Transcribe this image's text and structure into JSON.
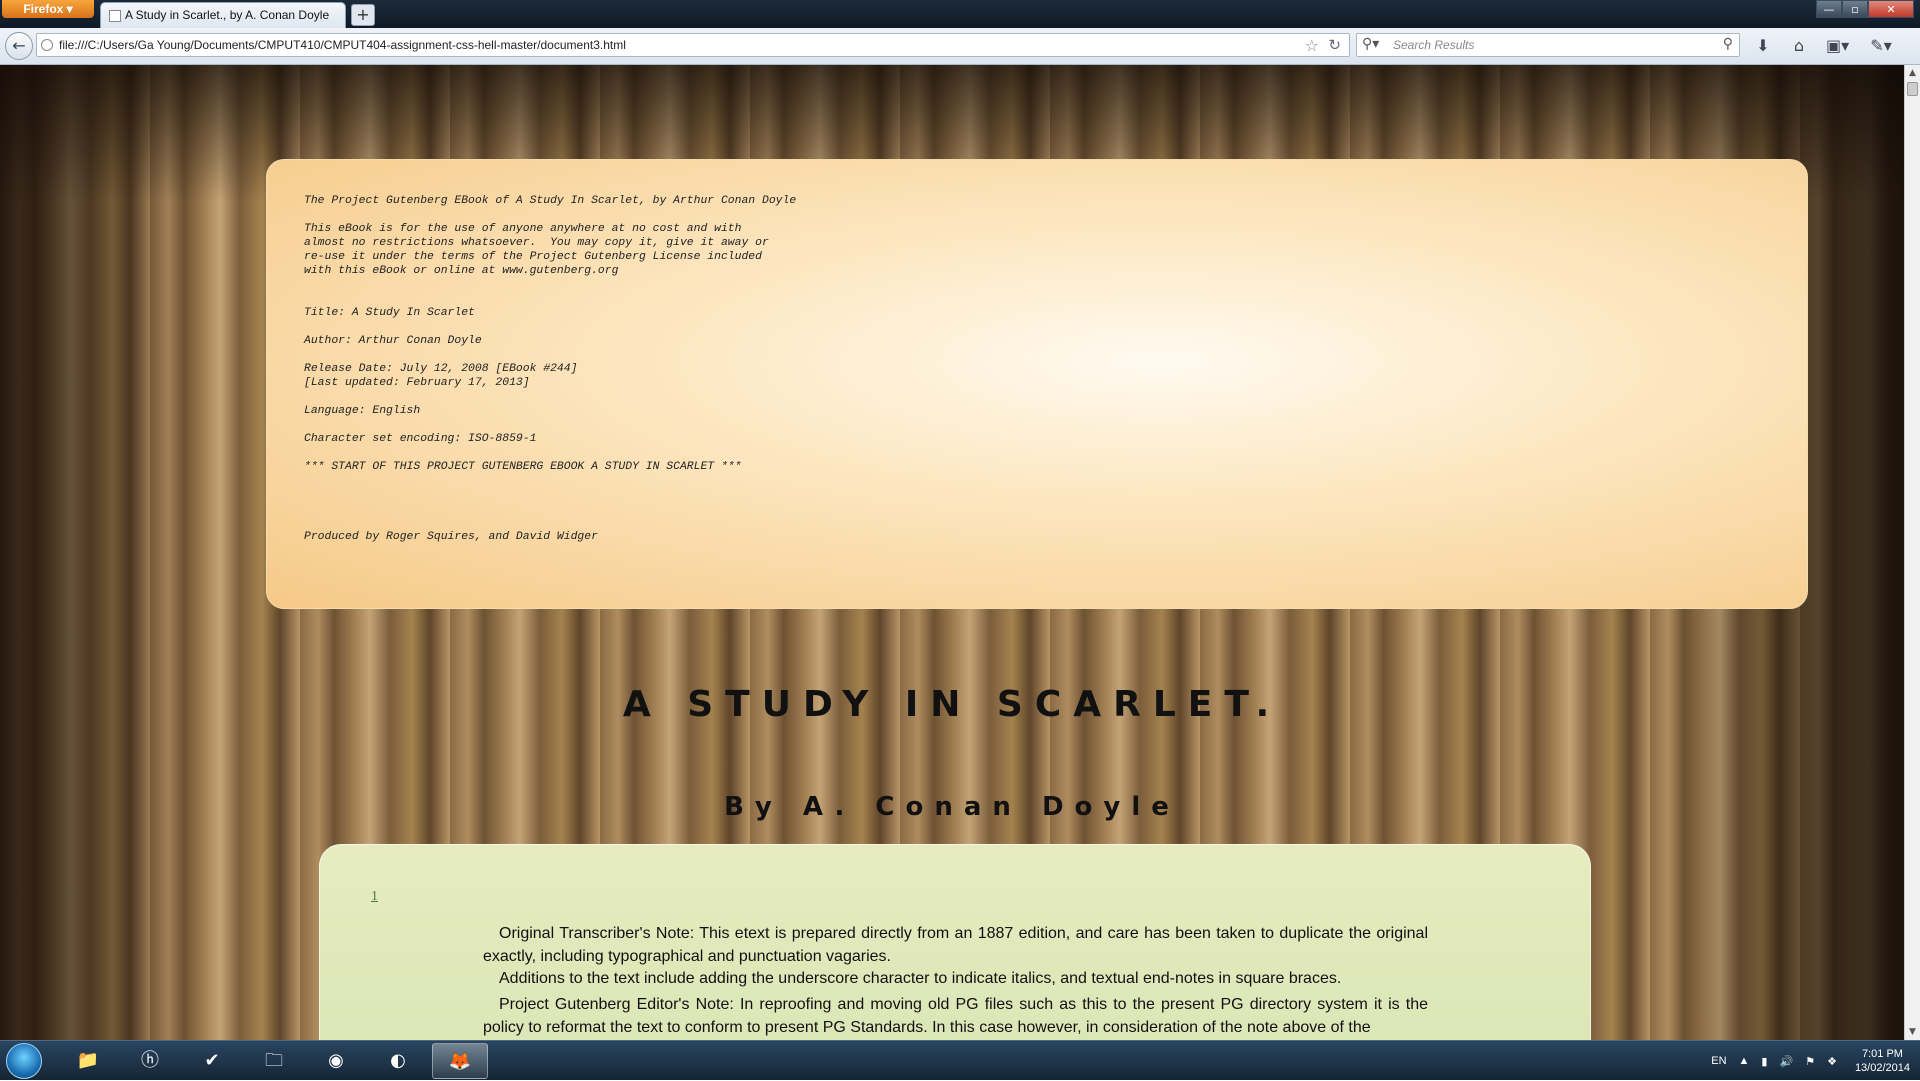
{
  "browser": {
    "menu_button": "Firefox ▾",
    "tab_title": "A Study in Scarlet., by A. Conan Doyle",
    "new_tab": "+",
    "url": "file:///C:/Users/Ga Young/Documents/CMPUT410/CMPUT404-assignment-css-hell-master/document3.html",
    "search_placeholder": "Search Results",
    "window_controls": {
      "minimize": "—",
      "maximize": "▫",
      "close": "✕"
    }
  },
  "page": {
    "license_text": "The Project Gutenberg EBook of A Study In Scarlet, by Arthur Conan Doyle\n\nThis eBook is for the use of anyone anywhere at no cost and with\nalmost no restrictions whatsoever.  You may copy it, give it away or\nre-use it under the terms of the Project Gutenberg License included\nwith this eBook or online at www.gutenberg.org\n\n\nTitle: A Study In Scarlet\n\nAuthor: Arthur Conan Doyle\n\nRelease Date: July 12, 2008 [EBook #244]\n[Last updated: February 17, 2013]\n\nLanguage: English\n\nCharacter set encoding: ISO-8859-1\n\n*** START OF THIS PROJECT GUTENBERG EBOOK A STUDY IN SCARLET ***\n\n\n\n\nProduced by Roger Squires, and David Widger",
    "title": "A STUDY IN SCARLET.",
    "author": "By A. Conan Doyle",
    "page_number": "1",
    "paragraphs": [
      "Original Transcriber's Note: This etext is prepared directly from an 1887 edition, and care has been taken to duplicate the original exactly, including typographical and punctuation vagaries.",
      "Additions to the text include adding the underscore character to indicate italics, and textual end-notes in square braces.",
      "Project Gutenberg Editor's Note: In reproofing and moving old PG files such as this to the present PG directory system it is the policy to reformat the text to conform to present PG Standards. In this case however, in consideration of the note above of the"
    ]
  },
  "taskbar": {
    "language": "EN",
    "time": "7:01 PM",
    "date": "13/02/2014"
  }
}
